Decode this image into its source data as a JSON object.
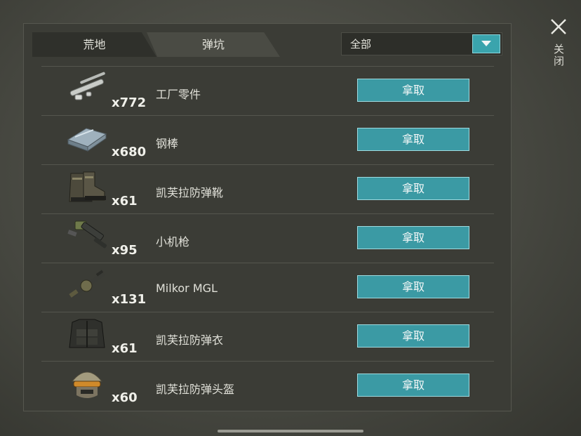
{
  "tabs": [
    {
      "label": "荒地"
    },
    {
      "label": "弹坑"
    }
  ],
  "filter": {
    "selected": "全部"
  },
  "close": {
    "label": "关闭"
  },
  "items": [
    {
      "name": "工厂零件",
      "qty": "x772",
      "button": "拿取",
      "icon": "factory-parts-icon"
    },
    {
      "name": "钢棒",
      "qty": "x680",
      "button": "拿取",
      "icon": "steel-bar-icon"
    },
    {
      "name": "凯芙拉防弹靴",
      "qty": "x61",
      "button": "拿取",
      "icon": "kevlar-boots-icon"
    },
    {
      "name": "小机枪",
      "qty": "x95",
      "button": "拿取",
      "icon": "small-machine-gun-icon"
    },
    {
      "name": "Milkor MGL",
      "qty": "x131",
      "button": "拿取",
      "icon": "grenade-launcher-icon"
    },
    {
      "name": "凯芙拉防弹衣",
      "qty": "x61",
      "button": "拿取",
      "icon": "kevlar-vest-icon"
    },
    {
      "name": "凯芙拉防弹头盔",
      "qty": "x60",
      "button": "拿取",
      "icon": "kevlar-helmet-icon"
    }
  ]
}
